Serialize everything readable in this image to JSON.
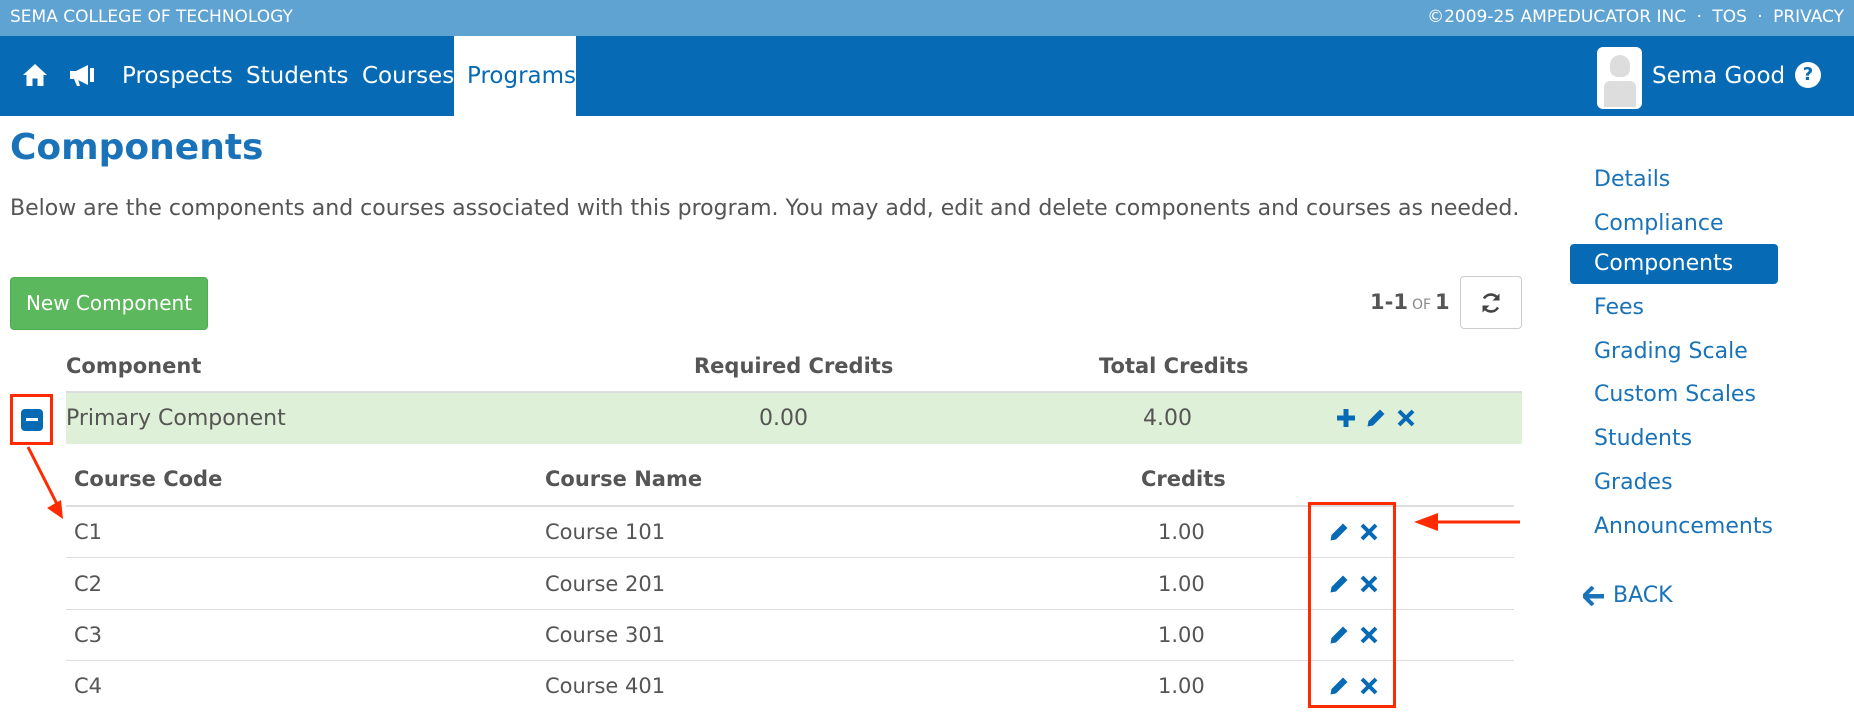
{
  "topbar": {
    "school": "SEMA COLLEGE OF TECHNOLOGY",
    "copyright": "©2009-25 AMPEDUCATOR INC",
    "sep1": "·",
    "tos": "TOS",
    "sep2": "·",
    "privacy": "PRIVACY"
  },
  "nav": {
    "prospects": "Prospects",
    "students": "Students",
    "courses": "Courses",
    "programs": "Programs",
    "user_name": "Sema Good",
    "help": "?"
  },
  "page": {
    "title": "Components",
    "description": "Below are the components and courses associated with this program. You may add, edit and delete components and courses as needed.",
    "new_button": "New Component"
  },
  "pager": {
    "range": "1-1",
    "of": "OF",
    "total": "1"
  },
  "table": {
    "headers": {
      "component": "Component",
      "required": "Required Credits",
      "total": "Total Credits"
    },
    "component": {
      "name": "Primary Component",
      "required": "0.00",
      "total": "4.00"
    },
    "course_headers": {
      "code": "Course Code",
      "name": "Course Name",
      "credits": "Credits"
    },
    "courses": [
      {
        "code": "C1",
        "name": "Course 101",
        "credits": "1.00"
      },
      {
        "code": "C2",
        "name": "Course 201",
        "credits": "1.00"
      },
      {
        "code": "C3",
        "name": "Course 301",
        "credits": "1.00"
      },
      {
        "code": "C4",
        "name": "Course 401",
        "credits": "1.00"
      }
    ]
  },
  "sidebar": {
    "items": [
      {
        "label": "Details"
      },
      {
        "label": "Compliance"
      },
      {
        "label": "Components"
      },
      {
        "label": "Fees"
      },
      {
        "label": "Grading Scale"
      },
      {
        "label": "Custom Scales"
      },
      {
        "label": "Students"
      },
      {
        "label": "Grades"
      },
      {
        "label": "Announcements"
      }
    ],
    "back": "BACK"
  },
  "colors": {
    "topbar": "#5fa3d3",
    "navbar": "#076ab5",
    "accent": "#1a73b8",
    "success": "#5cb85c",
    "component_row": "#dff0d8",
    "annotation": "#ff2a00"
  },
  "icons": {
    "home": "home-icon",
    "announce": "megaphone-icon",
    "refresh": "refresh-icon",
    "add": "plus-icon",
    "edit": "pencil-icon",
    "delete": "x-icon",
    "back": "arrow-left-icon",
    "help": "question-icon",
    "collapse": "minus-square-icon"
  }
}
